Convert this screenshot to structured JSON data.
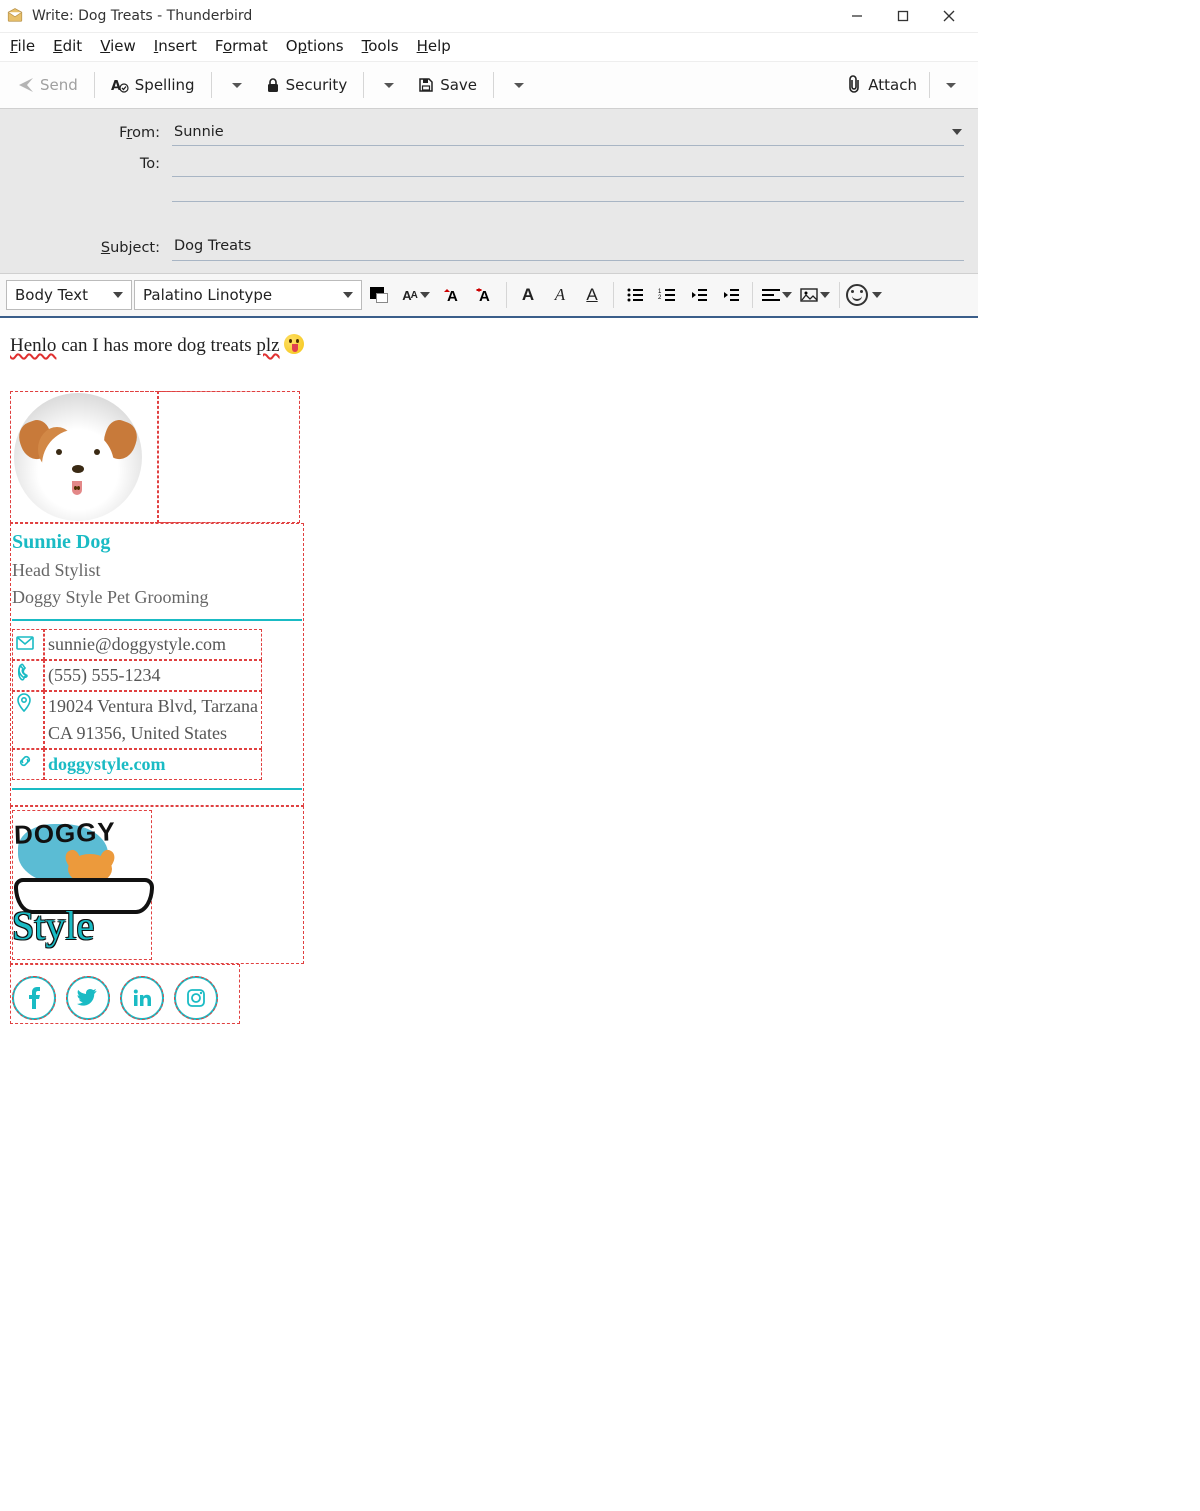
{
  "window_title": "Write: Dog Treats - Thunderbird",
  "menu": [
    "File",
    "Edit",
    "View",
    "Insert",
    "Format",
    "Options",
    "Tools",
    "Help"
  ],
  "toolbar": {
    "send": "Send",
    "spelling": "Spelling",
    "security": "Security",
    "save": "Save",
    "attach": "Attach"
  },
  "fields": {
    "from_label": "From:",
    "from_value": "Sunnie",
    "to_label": "To:",
    "to_value": "",
    "subject_label": "Subject:",
    "subject_value": "Dog Treats"
  },
  "format": {
    "para_style": "Body Text",
    "font_name": "Palatino Linotype"
  },
  "body": {
    "word1": "Henlo",
    "middle": " can I has more dog treats ",
    "word2": "plz"
  },
  "signature": {
    "name": "Sunnie Dog",
    "role": "Head Stylist",
    "company": "Doggy Style Pet Grooming",
    "email": "sunnie@doggystyle.com",
    "phone": "(555) 555-1234",
    "address_line1": "19024 Ventura Blvd, Tarzana",
    "address_line2": "CA 91356, United States",
    "website": "doggystyle.com",
    "logo_top": "DOGGY",
    "logo_bottom": "Style",
    "socials": [
      "facebook",
      "twitter",
      "linkedin",
      "instagram"
    ]
  }
}
